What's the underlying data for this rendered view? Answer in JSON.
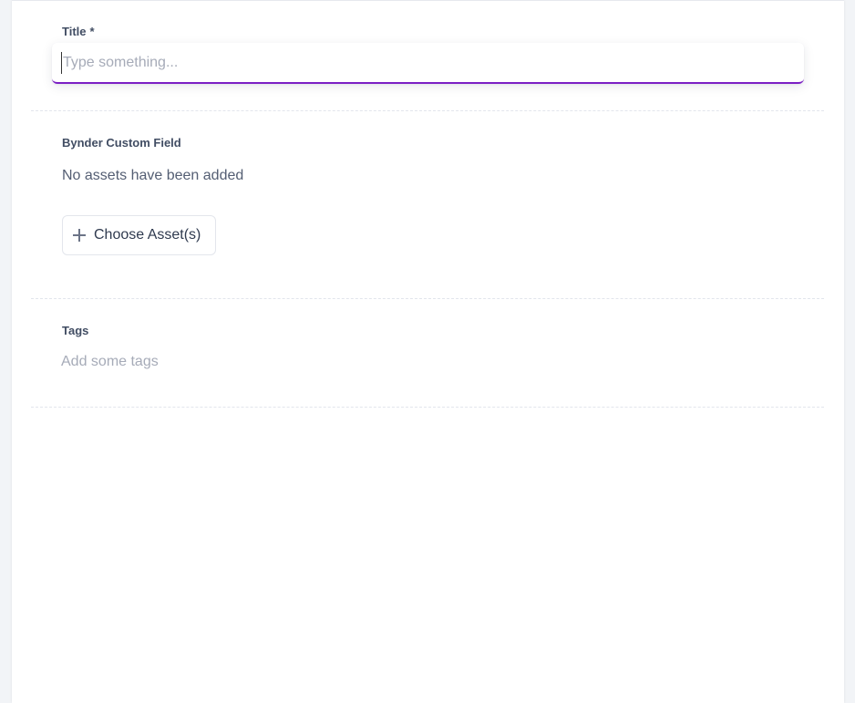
{
  "form": {
    "title_field": {
      "label": "Title",
      "required_marker": "*",
      "value": "",
      "placeholder": "Type something..."
    },
    "bynder_field": {
      "label": "Bynder Custom Field",
      "empty_text": "No assets have been added",
      "choose_button_label": "Choose Asset(s)",
      "choose_button_icon": "plus-icon"
    },
    "tags_field": {
      "label": "Tags",
      "value": "",
      "placeholder": "Add some tags"
    }
  },
  "colors": {
    "focus_accent": "#7b1fc4",
    "label_text": "#414d63",
    "placeholder_text": "#a6abb8",
    "page_background": "#f2f4f7",
    "panel_background": "#ffffff"
  }
}
